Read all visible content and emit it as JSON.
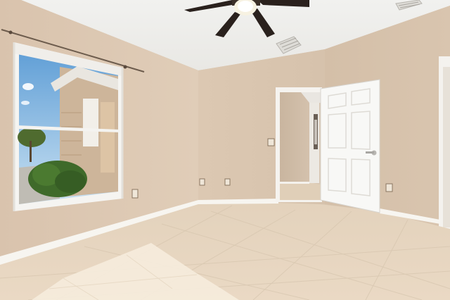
{
  "scene": {
    "description_free": true,
    "colors": {
      "ceiling": "#f3f3f1",
      "wall_left": "#dbc6b0",
      "wall_back": "#d8c4ae",
      "wall_right": "#d6c1aa",
      "floor": "#e2d3bf",
      "baseboard": "#f7f5f0",
      "door": "#f8f8f6",
      "fan_blade": "#2a211d",
      "sky": "#9fc9ea",
      "hedge": "#3f6a2a"
    }
  }
}
